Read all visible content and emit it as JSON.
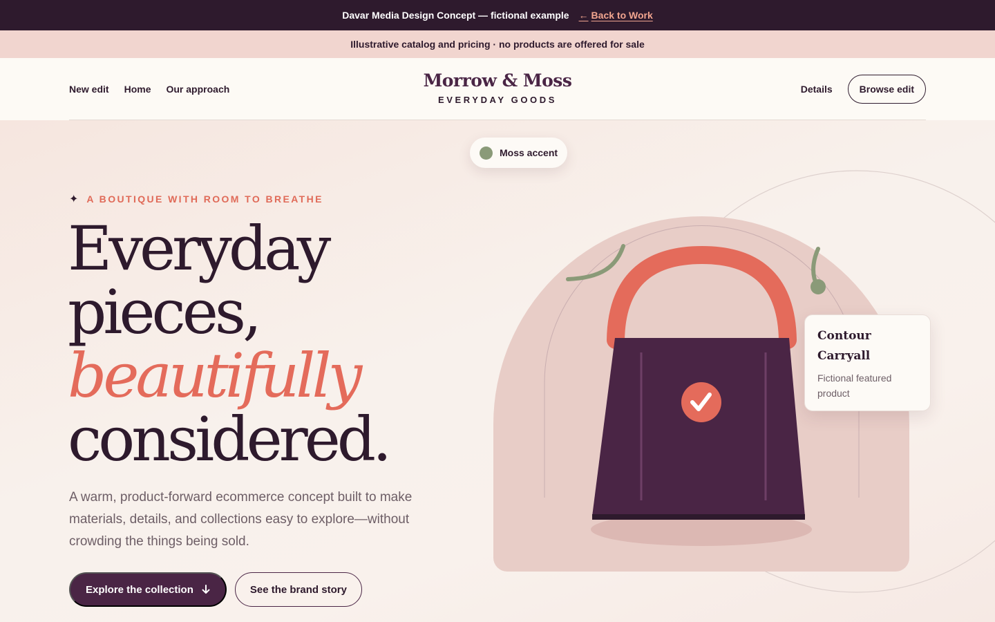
{
  "topbar": {
    "text": "Davar Media Design Concept — fictional example",
    "back_link": "Back to Work",
    "back_icon": "arrow-left-icon"
  },
  "notice": {
    "text": "Illustrative catalog and pricing · no products are offered for sale"
  },
  "nav": {
    "left": [
      "New edit",
      "Home",
      "Our approach"
    ],
    "details": "Details",
    "browse": "Browse edit"
  },
  "brand": {
    "name": "Morrow & Moss",
    "tagline": "EVERYDAY GOODS"
  },
  "hero": {
    "eyebrow": "A BOUTIQUE WITH ROOM TO BREATHE",
    "eyebrow_icon": "sparkle-icon",
    "headline": [
      "Everyday",
      "pieces,",
      "beautifully",
      "considered."
    ],
    "lead": "A warm, product-forward ecommerce concept built to make materials, details, and collections easy to explore—without crowding the things being sold.",
    "primary_cta": "Explore the collection",
    "primary_cta_icon": "arrow-down-icon",
    "secondary_cta": "See the brand story"
  },
  "illustration": {
    "pill_label": "Moss accent",
    "product_name_1": "Contour",
    "product_name_2": "Carryall",
    "product_sub": "Fictional featured product",
    "check_icon": "checkmark-icon"
  },
  "colors": {
    "plum": "#4a2545",
    "ink": "#2e1a2d",
    "coral": "#e46b5b",
    "moss": "#8a9a78",
    "blush": "#f1d5cf",
    "cream": "#fdfaf5"
  }
}
